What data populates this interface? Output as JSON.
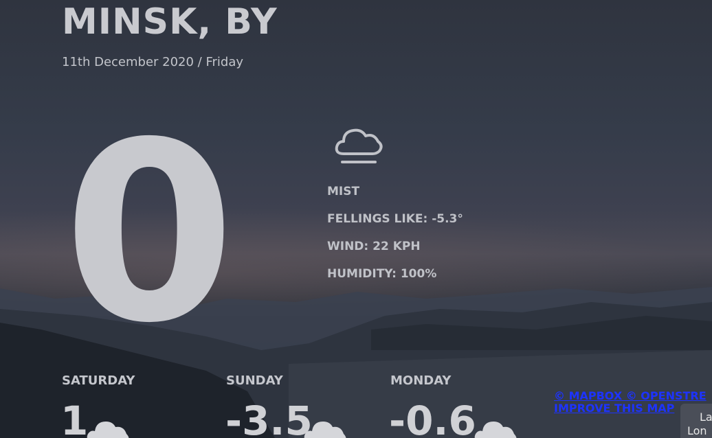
{
  "header": {
    "city": "MINSK, BY",
    "date": "11th December 2020 / Friday"
  },
  "current": {
    "temperature": "0",
    "icon": "cloud-fog-icon",
    "condition": "MIST",
    "feels_like": "FELLINGS LIKE: -5.3°",
    "wind": "WIND: 22 KPH",
    "humidity": "HUMIDITY: 100%"
  },
  "forecast": [
    {
      "day": "SATURDAY",
      "temp": "1",
      "icon": "cloud-icon"
    },
    {
      "day": "SUNDAY",
      "temp": "-3.5",
      "icon": "cloud-icon"
    },
    {
      "day": "MONDAY",
      "temp": "-0.6",
      "icon": "cloud-icon"
    }
  ],
  "map": {
    "attribution_line1": "© MAPBOX © OPENSTRE",
    "attribution_line2": "IMPROVE THIS MAP",
    "coords_label1": "La",
    "coords_label2": "Lon"
  },
  "colors": {
    "text": "#c5c7cd",
    "link": "#1d33ff"
  }
}
